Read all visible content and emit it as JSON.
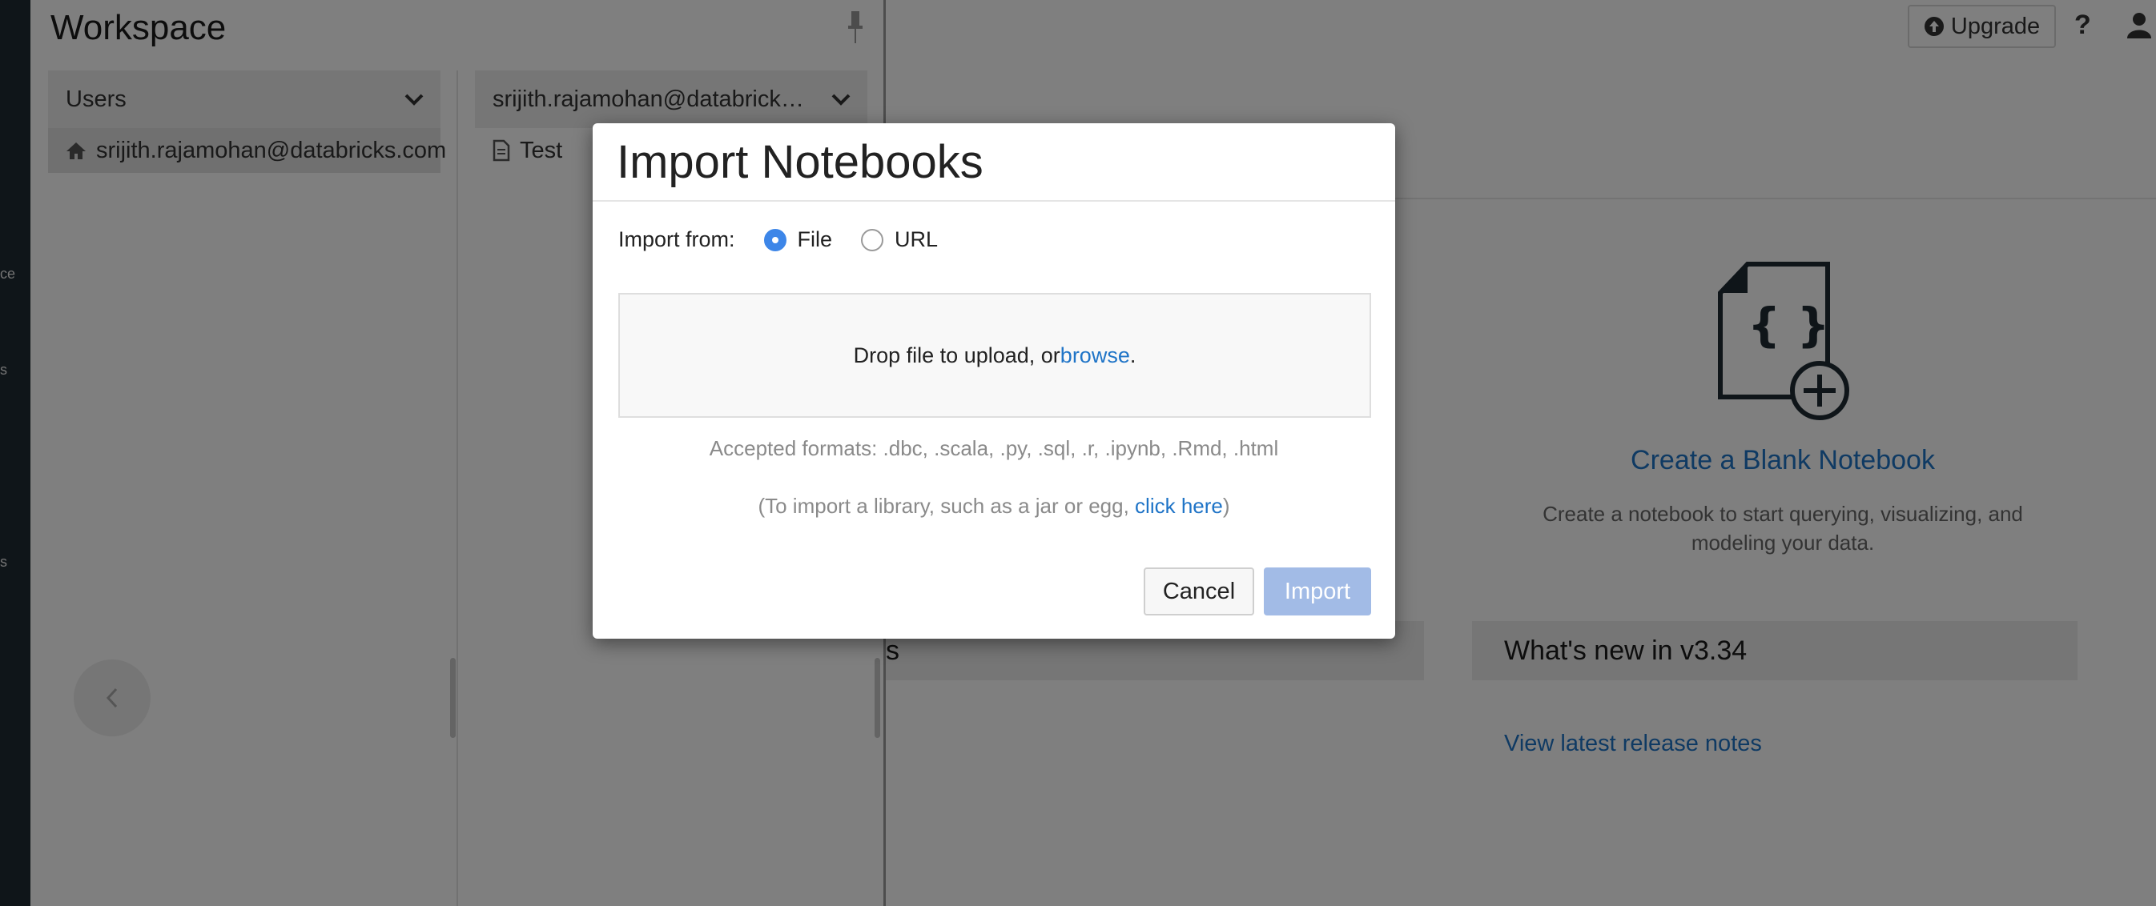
{
  "sidebar": {
    "fragments": [
      "ce",
      "s",
      "s"
    ]
  },
  "workspace": {
    "title": "Workspace",
    "left_column": {
      "header": "Users",
      "items": [
        {
          "label": "srijith.rajamohan@databricks.com"
        }
      ]
    },
    "right_column": {
      "header": "srijith.rajamohan@databricks.com",
      "items": [
        {
          "label": "Test"
        }
      ]
    }
  },
  "topbar": {
    "upgrade_label": "Upgrade",
    "help_label": "?"
  },
  "main": {
    "create_link": "Create a Blank Notebook",
    "create_desc_line1": "Create a notebook to start querying, visualizing, and",
    "create_desc_line2": "modeling your data.",
    "band_left_label": "s",
    "whats_new": "What's new in v3.34",
    "release_link": "View latest release notes"
  },
  "modal": {
    "title": "Import Notebooks",
    "import_from_label": "Import from:",
    "options": [
      {
        "label": "File",
        "selected": true
      },
      {
        "label": "URL",
        "selected": false
      }
    ],
    "drop_text": "Drop file to upload, or ",
    "browse_link": "browse",
    "drop_suffix": ".",
    "formats": "Accepted formats: .dbc, .scala, .py, .sql, .r, .ipynb, .Rmd, .html",
    "lib_prefix": "(To import a library, such as a jar or egg, ",
    "lib_link": "click here",
    "lib_suffix": ")",
    "cancel_label": "Cancel",
    "import_label": "Import"
  },
  "colors": {
    "accent": "#1f74c7",
    "radio": "#3d86e8",
    "import_disabled": "#a2bbe6",
    "sidebar": "#1e2a33"
  }
}
